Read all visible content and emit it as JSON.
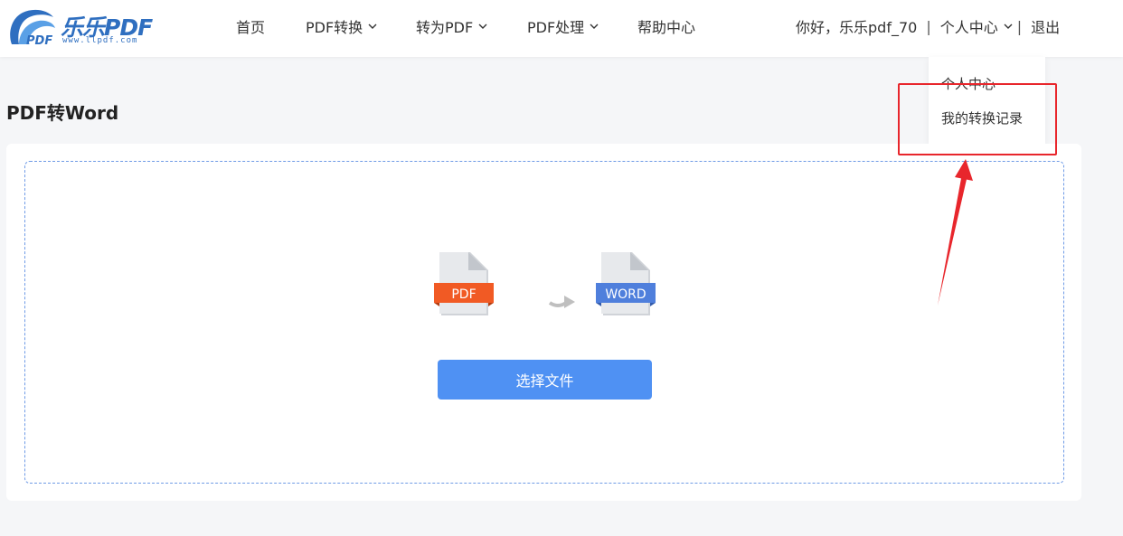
{
  "logo": {
    "brand": "乐乐PDF",
    "url": "www.llpdf.com"
  },
  "nav": {
    "items": [
      {
        "label": "首页"
      },
      {
        "label": "PDF转换"
      },
      {
        "label": "转为PDF"
      },
      {
        "label": "PDF处理"
      },
      {
        "label": "帮助中心"
      }
    ]
  },
  "user": {
    "greeting": "你好，乐乐pdf_70",
    "separator": "|",
    "account": "个人中心",
    "logout": "退出"
  },
  "dropdown": {
    "items": [
      {
        "label": "个人中心"
      },
      {
        "label": "我的转换记录"
      }
    ]
  },
  "main": {
    "title": "PDF转Word",
    "source_badge": "PDF",
    "target_badge": "WORD",
    "select_button": "选择文件"
  },
  "colors": {
    "accent": "#4f91f3",
    "pdf_badge": "#f15a24",
    "word_badge": "#4f7fdc",
    "annotation": "#e8262c"
  },
  "icons": {
    "chevron": "chevron-down-icon",
    "pdf": "pdf-file-icon",
    "word": "word-file-icon",
    "convert": "arrow-right-icon"
  }
}
